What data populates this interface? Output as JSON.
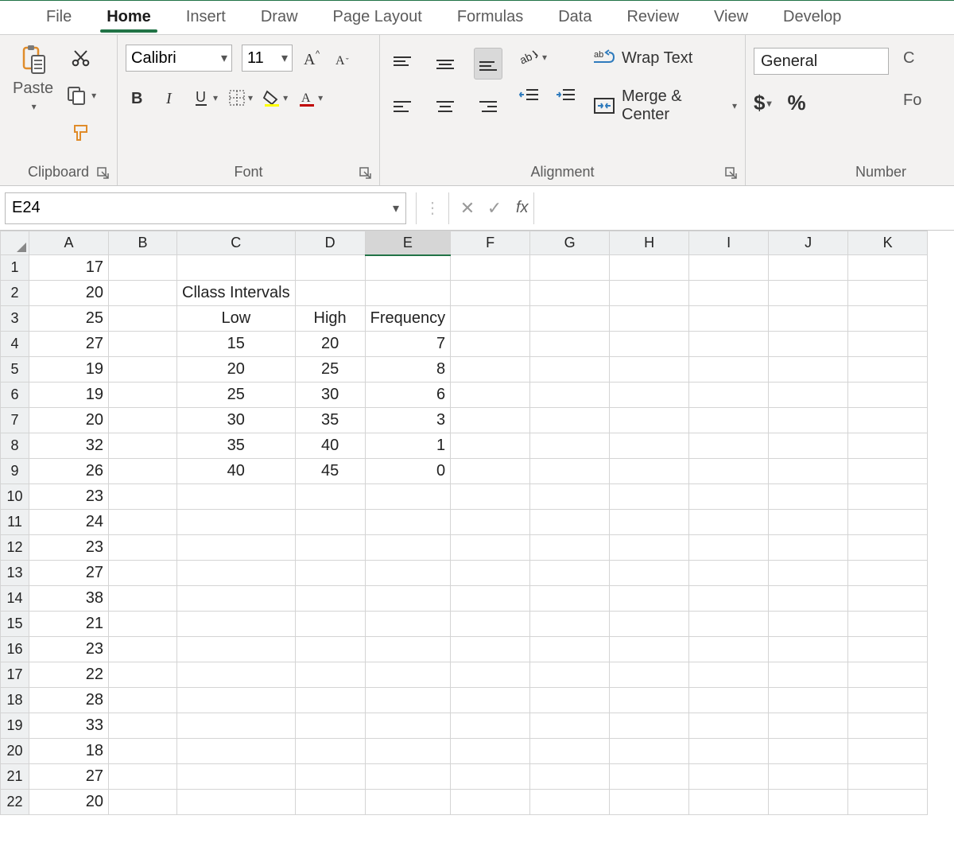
{
  "tabs": [
    "File",
    "Home",
    "Insert",
    "Draw",
    "Page Layout",
    "Formulas",
    "Data",
    "Review",
    "View",
    "Develop"
  ],
  "active_tab": "Home",
  "ribbon": {
    "clipboard": {
      "paste": "Paste",
      "label": "Clipboard"
    },
    "font": {
      "name": "Calibri",
      "size": "11",
      "label": "Font"
    },
    "alignment": {
      "wrap": "Wrap Text",
      "merge": "Merge & Center",
      "label": "Alignment"
    },
    "number": {
      "format": "General",
      "currency_sym": "$",
      "percent_sym": "%",
      "label": "Number",
      "trailing1": "C",
      "trailing2": "Fo"
    }
  },
  "name_box": "E24",
  "fx_label": "fx",
  "formula": "",
  "columns": [
    "A",
    "B",
    "C",
    "D",
    "E",
    "F",
    "G",
    "H",
    "I",
    "J",
    "K"
  ],
  "selected_column": "E",
  "row_count": 22,
  "cells": {
    "colA": [
      "17",
      "20",
      "25",
      "27",
      "19",
      "19",
      "20",
      "32",
      "26",
      "23",
      "24",
      "23",
      "27",
      "38",
      "21",
      "23",
      "22",
      "28",
      "33",
      "18",
      "27",
      "20"
    ],
    "class_intervals_title": "Cllass Intervals",
    "headers": {
      "low": "Low",
      "high": "High",
      "freq": "Frequency"
    },
    "table": [
      {
        "low": "15",
        "high": "20",
        "freq": "7"
      },
      {
        "low": "20",
        "high": "25",
        "freq": "8"
      },
      {
        "low": "25",
        "high": "30",
        "freq": "6"
      },
      {
        "low": "30",
        "high": "35",
        "freq": "3"
      },
      {
        "low": "35",
        "high": "40",
        "freq": "1"
      },
      {
        "low": "40",
        "high": "45",
        "freq": "0"
      }
    ]
  }
}
